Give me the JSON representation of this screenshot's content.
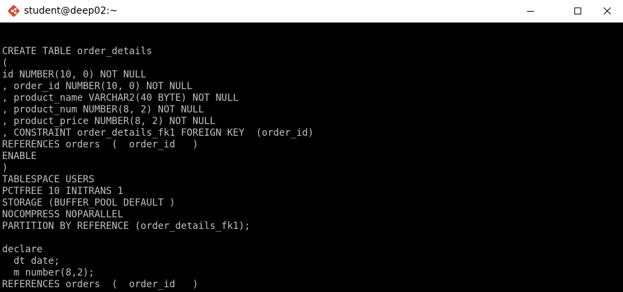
{
  "window": {
    "title": "student@deep02:~"
  },
  "icons": {
    "app": "git-bash-icon",
    "minimize": "minimize-icon",
    "maximize": "maximize-icon",
    "close": "close-icon"
  },
  "colors": {
    "terminal_bg": "#000000",
    "terminal_fg": "#c0c0c0",
    "titlebar_bg": "#ffffff",
    "icon_accent": "#e24329"
  },
  "terminal": {
    "lines": [
      "CREATE TABLE order_details",
      "(",
      "id NUMBER(10, 0) NOT NULL",
      ", order_id NUMBER(10, 0) NOT NULL",
      ", product_name VARCHAR2(40 BYTE) NOT NULL",
      ", product_num NUMBER(8, 2) NOT NULL",
      ", product_price NUMBER(8, 2) NOT NULL",
      ", CONSTRAINT order_details_fk1 FOREIGN KEY  (order_id)",
      "REFERENCES orders  (  order_id   )",
      "ENABLE",
      ")",
      "TABLESPACE USERS",
      "PCTFREE 10 INITRANS 1",
      "STORAGE (BUFFER_POOL DEFAULT )",
      "NOCOMPRESS NOPARALLEL",
      "PARTITION BY REFERENCE (order_details_fk1);",
      "",
      "declare",
      "  dt date;",
      "  m number(8,2);",
      "REFERENCES orders  (  order_id   )"
    ]
  }
}
